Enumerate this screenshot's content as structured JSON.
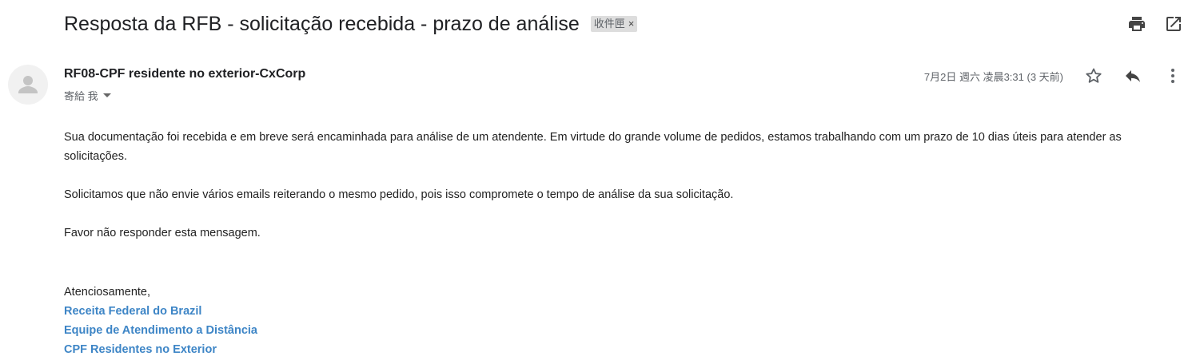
{
  "subject": "Resposta da RFB - solicitação recebida - prazo de análise",
  "label": "收件匣",
  "label_close": "×",
  "sender": "RF08-CPF residente no exterior-CxCorp",
  "recipient": "寄給 我",
  "date": "7月2日 週六 凌晨3:31 (3 天前)",
  "body": [
    "Sua documentação foi recebida e em breve será encaminhada para análise de um atendente. Em virtude do grande volume de pedidos, estamos trabalhando com um prazo de 10 dias úteis para atender as solicitações.",
    "Solicitamos que não envie vários emails reiterando o mesmo pedido, pois isso compromete o tempo de análise da sua solicitação.",
    "Favor não responder esta mensagem."
  ],
  "signature": {
    "closing": "Atenciosamente,",
    "lines": [
      "Receita Federal do Brazil",
      "Equipe de Atendimento a Distância",
      "CPF Residentes no Exterior"
    ]
  },
  "colors": {
    "link": "#3d85c6",
    "icon": "#5f6368",
    "chip_bg": "#dddddd"
  }
}
